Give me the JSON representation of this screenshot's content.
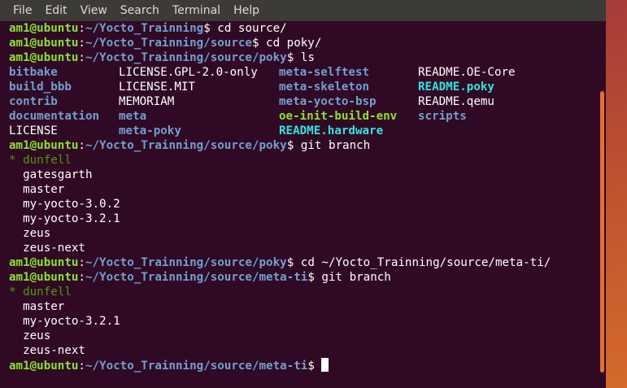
{
  "menubar": {
    "items": [
      "File",
      "Edit",
      "View",
      "Search",
      "Terminal",
      "Help"
    ]
  },
  "prompt_user": "am1@ubuntu",
  "lines": [
    {
      "type": "prompt",
      "path": "~/Yocto_Trainning",
      "cmd": " cd source/"
    },
    {
      "type": "prompt",
      "path": "~/Yocto_Trainning/source",
      "cmd": " cd poky/"
    },
    {
      "type": "prompt",
      "path": "~/Yocto_Trainning/source/poky",
      "cmd": " ls"
    },
    {
      "type": "ls",
      "cells": [
        {
          "text": "bitbake",
          "kind": "dir"
        },
        {
          "text": "LICENSE.GPL-2.0-only",
          "kind": "file"
        },
        {
          "text": "meta-selftest",
          "kind": "dir"
        },
        {
          "text": "README.OE-Core",
          "kind": "file"
        }
      ]
    },
    {
      "type": "ls",
      "cells": [
        {
          "text": "build_bbb",
          "kind": "dir"
        },
        {
          "text": "LICENSE.MIT",
          "kind": "file"
        },
        {
          "text": "meta-skeleton",
          "kind": "dir"
        },
        {
          "text": "README.poky",
          "kind": "link"
        }
      ]
    },
    {
      "type": "ls",
      "cells": [
        {
          "text": "contrib",
          "kind": "dir"
        },
        {
          "text": "MEMORIAM",
          "kind": "file"
        },
        {
          "text": "meta-yocto-bsp",
          "kind": "dir"
        },
        {
          "text": "README.qemu",
          "kind": "file"
        }
      ]
    },
    {
      "type": "ls",
      "cells": [
        {
          "text": "documentation",
          "kind": "dir"
        },
        {
          "text": "meta",
          "kind": "dir"
        },
        {
          "text": "oe-init-build-env",
          "kind": "exe"
        },
        {
          "text": "scripts",
          "kind": "dir"
        }
      ]
    },
    {
      "type": "ls",
      "cells": [
        {
          "text": "LICENSE",
          "kind": "file"
        },
        {
          "text": "meta-poky",
          "kind": "dir"
        },
        {
          "text": "README.hardware",
          "kind": "link"
        },
        {
          "text": "",
          "kind": "file"
        }
      ]
    },
    {
      "type": "prompt",
      "path": "~/Yocto_Trainning/source/poky",
      "cmd": " git branch"
    },
    {
      "type": "current",
      "text": "* dunfell"
    },
    {
      "type": "plain",
      "text": "  gatesgarth"
    },
    {
      "type": "plain",
      "text": "  master"
    },
    {
      "type": "plain",
      "text": "  my-yocto-3.0.2"
    },
    {
      "type": "plain",
      "text": "  my-yocto-3.2.1"
    },
    {
      "type": "plain",
      "text": "  zeus"
    },
    {
      "type": "plain",
      "text": "  zeus-next"
    },
    {
      "type": "prompt",
      "path": "~/Yocto_Trainning/source/poky",
      "cmd": " cd ~/Yocto_Trainning/source/meta-ti/"
    },
    {
      "type": "prompt",
      "path": "~/Yocto_Trainning/source/meta-ti",
      "cmd": " git branch"
    },
    {
      "type": "current",
      "text": "* dunfell"
    },
    {
      "type": "plain",
      "text": "  master"
    },
    {
      "type": "plain",
      "text": "  my-yocto-3.2.1"
    },
    {
      "type": "plain",
      "text": "  zeus"
    },
    {
      "type": "plain",
      "text": "  zeus-next"
    },
    {
      "type": "prompt",
      "path": "~/Yocto_Trainning/source/meta-ti",
      "cmd": " ",
      "cursor": true
    }
  ],
  "colors": {
    "background": "#300a24",
    "prompt_user": "#8ae234",
    "prompt_path": "#729fcf",
    "directory": "#729fcf",
    "symlink": "#34e2e2",
    "executable": "#8ae234",
    "current_branch": "#4e9a06",
    "scrollbar": "#e0703a"
  }
}
